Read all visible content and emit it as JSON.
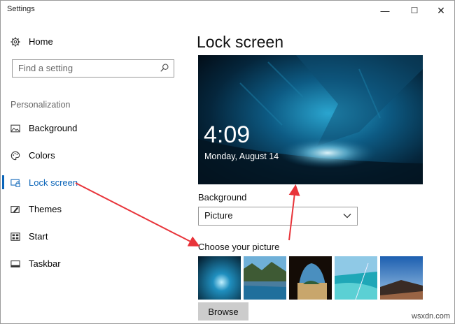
{
  "window": {
    "title": "Settings",
    "minimize": "—",
    "maximize": "☐",
    "close": "✕"
  },
  "sidebar": {
    "home_label": "Home",
    "search_placeholder": "Find a setting",
    "section_label": "Personalization",
    "items": [
      {
        "label": "Background",
        "icon": "image-icon"
      },
      {
        "label": "Colors",
        "icon": "palette-icon"
      },
      {
        "label": "Lock screen",
        "icon": "lock-screen-icon",
        "active": true
      },
      {
        "label": "Themes",
        "icon": "themes-icon"
      },
      {
        "label": "Start",
        "icon": "start-icon"
      },
      {
        "label": "Taskbar",
        "icon": "taskbar-icon"
      }
    ]
  },
  "main": {
    "title": "Lock screen",
    "preview_time": "4:09",
    "preview_date": "Monday, August 14",
    "background_label": "Background",
    "background_value": "Picture",
    "choose_label": "Choose your picture",
    "browse_label": "Browse"
  },
  "colors": {
    "accent": "#0a64b8",
    "annotation_arrow": "#e8343a"
  },
  "watermark": "wsxdn.com"
}
